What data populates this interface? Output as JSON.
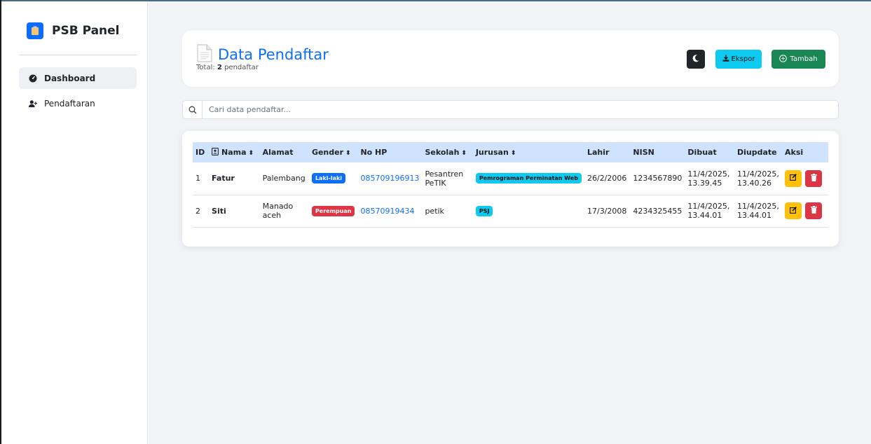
{
  "sidebar": {
    "brand": "PSB Panel",
    "items": [
      {
        "label": "Dashboard",
        "icon": "gauge-icon",
        "active": true
      },
      {
        "label": "Pendaftaran",
        "icon": "user-plus-icon",
        "active": false
      }
    ]
  },
  "header": {
    "title": "Data Pendaftar",
    "subtitle_prefix": "Total:",
    "subtitle_count": "2",
    "subtitle_suffix": "pendaftar",
    "theme_icon": "moon-icon",
    "export_label": "Ekspor",
    "add_label": "Tambah"
  },
  "search": {
    "placeholder": "Cari data pendaftar..."
  },
  "table": {
    "columns": [
      "ID",
      "Nama",
      "Alamat",
      "Gender",
      "No HP",
      "Sekolah",
      "Jurusan",
      "Lahir",
      "NISN",
      "Dibuat",
      "Diupdate",
      "Aksi"
    ],
    "rows": [
      {
        "id": "1",
        "nama": "Fatur",
        "alamat": "Palembang",
        "gender": "Laki-laki",
        "no_hp": "085709196913",
        "sekolah": "Pesantren PeTIK",
        "jurusan": "Pemrograman Perminatan Web",
        "lahir": "26/2/2006",
        "nisn": "1234567890",
        "dibuat": "11/4/2025, 13.39.45",
        "diupdate": "11/4/2025, 13.40.26"
      },
      {
        "id": "2",
        "nama": "Siti",
        "alamat": "Manado aceh",
        "gender": "Perempuan",
        "no_hp": "08570919434",
        "sekolah": "petik",
        "jurusan": "PSJ",
        "lahir": "17/3/2008",
        "nisn": "4234325455",
        "dibuat": "11/4/2025, 13.44.01",
        "diupdate": "11/4/2025, 13.44.01"
      }
    ]
  },
  "colors": {
    "primary": "#0d6efd",
    "info": "#0dcaf0",
    "success": "#198754",
    "danger": "#dc3545",
    "warning": "#ffc107",
    "dark": "#212529"
  }
}
